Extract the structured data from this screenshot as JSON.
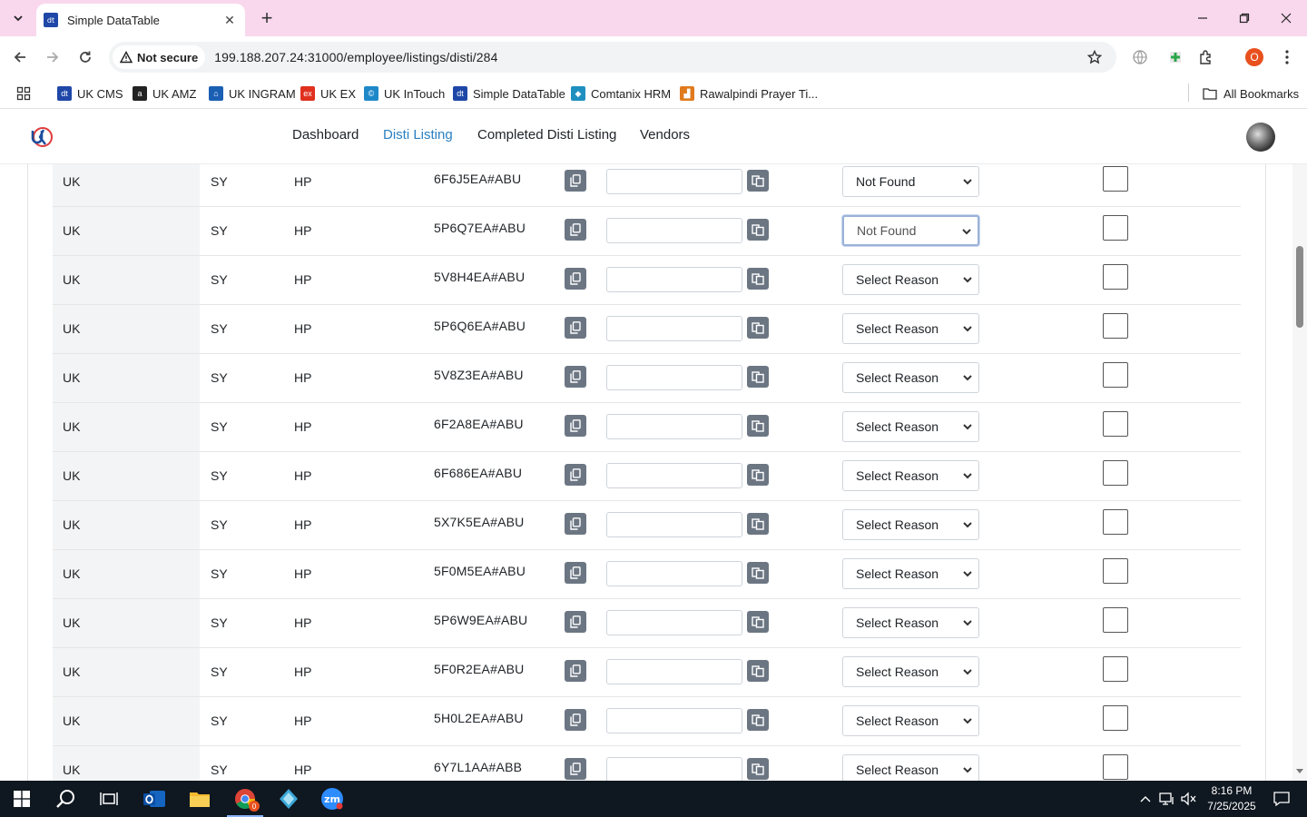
{
  "browser": {
    "tab_title": "Simple DataTable",
    "tab_favicon_text": "dt",
    "security_label": "Not secure",
    "url": "199.188.207.24:31000/employee/listings/disti/284",
    "profile_initial": "O",
    "bookmarks": [
      {
        "label": "UK CMS",
        "icon": "dt-icon",
        "color": "#1f47a8",
        "glyph": "dt"
      },
      {
        "label": "UK AMZ",
        "icon": "amazon-icon",
        "color": "#222222",
        "glyph": "a"
      },
      {
        "label": "UK INGRAM",
        "icon": "ingram-icon",
        "color": "#1a5fb4",
        "glyph": "⌂"
      },
      {
        "label": "UK EX",
        "icon": "ex-icon",
        "color": "#e0301e",
        "glyph": "ex"
      },
      {
        "label": "UK InTouch",
        "icon": "intouch-icon",
        "color": "#1e88c9",
        "glyph": "©"
      },
      {
        "label": "Simple DataTable",
        "icon": "dt-icon",
        "color": "#1f47a8",
        "glyph": "dt"
      },
      {
        "label": "Comtanix HRM",
        "icon": "comtanix-icon",
        "color": "#1f8fbf",
        "glyph": "◆"
      },
      {
        "label": "Rawalpindi Prayer Ti...",
        "icon": "prayer-icon",
        "color": "#e07a1e",
        "glyph": "▟"
      }
    ],
    "all_bookmarks": "All Bookmarks"
  },
  "nav": {
    "items": [
      "Dashboard",
      "Disti Listing",
      "Completed Disti Listing",
      "Vendors"
    ],
    "active": "Disti Listing"
  },
  "table": {
    "rows": [
      {
        "region": "UK",
        "code": "SY",
        "brand": "HP",
        "sku": "6F6J5EA#ABU",
        "value": "",
        "reason": "Not Found",
        "checked": false
      },
      {
        "region": "UK",
        "code": "SY",
        "brand": "HP",
        "sku": "5P6Q7EA#ABU",
        "value": "",
        "reason": "Not Found",
        "checked": false
      },
      {
        "region": "UK",
        "code": "SY",
        "brand": "HP",
        "sku": "5V8H4EA#ABU",
        "value": "",
        "reason": "Select Reason",
        "checked": false
      },
      {
        "region": "UK",
        "code": "SY",
        "brand": "HP",
        "sku": "5P6Q6EA#ABU",
        "value": "",
        "reason": "Select Reason",
        "checked": false
      },
      {
        "region": "UK",
        "code": "SY",
        "brand": "HP",
        "sku": "5V8Z3EA#ABU",
        "value": "",
        "reason": "Select Reason",
        "checked": false
      },
      {
        "region": "UK",
        "code": "SY",
        "brand": "HP",
        "sku": "6F2A8EA#ABU",
        "value": "",
        "reason": "Select Reason",
        "checked": false
      },
      {
        "region": "UK",
        "code": "SY",
        "brand": "HP",
        "sku": "6F686EA#ABU",
        "value": "",
        "reason": "Select Reason",
        "checked": false
      },
      {
        "region": "UK",
        "code": "SY",
        "brand": "HP",
        "sku": "5X7K5EA#ABU",
        "value": "",
        "reason": "Select Reason",
        "checked": false
      },
      {
        "region": "UK",
        "code": "SY",
        "brand": "HP",
        "sku": "5F0M5EA#ABU",
        "value": "",
        "reason": "Select Reason",
        "checked": false
      },
      {
        "region": "UK",
        "code": "SY",
        "brand": "HP",
        "sku": "5P6W9EA#ABU",
        "value": "",
        "reason": "Select Reason",
        "checked": false
      },
      {
        "region": "UK",
        "code": "SY",
        "brand": "HP",
        "sku": "5F0R2EA#ABU",
        "value": "",
        "reason": "Select Reason",
        "checked": false
      },
      {
        "region": "UK",
        "code": "SY",
        "brand": "HP",
        "sku": "5H0L2EA#ABU",
        "value": "",
        "reason": "Select Reason",
        "checked": false
      },
      {
        "region": "UK",
        "code": "SY",
        "brand": "HP",
        "sku": "6Y7L1AA#ABB",
        "value": "",
        "reason": "Select Reason",
        "checked": false
      }
    ],
    "focused_reason_row": 1
  },
  "taskbar": {
    "time": "8:16 PM",
    "date": "7/25/2025",
    "chrome_badge": "0",
    "apps": [
      "start-icon",
      "search-icon",
      "task-view-icon",
      "outlook-icon",
      "file-explorer-icon",
      "chrome-icon",
      "app-diamond-icon",
      "zoom-icon"
    ]
  }
}
